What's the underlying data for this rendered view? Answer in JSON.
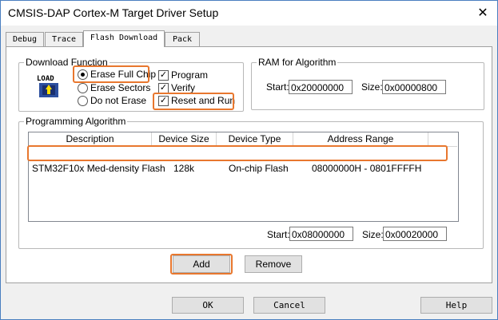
{
  "window": {
    "title": "CMSIS-DAP Cortex-M Target Driver Setup",
    "close_glyph": "✕"
  },
  "tabs": [
    {
      "label": "Debug"
    },
    {
      "label": "Trace"
    },
    {
      "label": "Flash Download"
    },
    {
      "label": "Pack"
    }
  ],
  "download_function": {
    "legend": "Download Function",
    "icon_text": "LOAD",
    "erase_options": [
      {
        "label": "Erase Full Chip",
        "selected": true
      },
      {
        "label": "Erase Sectors",
        "selected": false
      },
      {
        "label": "Do not Erase",
        "selected": false
      }
    ],
    "checks": [
      {
        "label": "Program",
        "checked": true
      },
      {
        "label": "Verify",
        "checked": true
      },
      {
        "label": "Reset and Run",
        "checked": true
      }
    ]
  },
  "ram": {
    "legend": "RAM for Algorithm",
    "start_label": "Start:",
    "start_value": "0x20000000",
    "size_label": "Size:",
    "size_value": "0x00000800"
  },
  "algorithm": {
    "legend": "Programming Algorithm",
    "columns": [
      "Description",
      "Device Size",
      "Device Type",
      "Address Range"
    ],
    "rows": [
      {
        "description": "STM32F10x Med-density Flash",
        "size": "128k",
        "type": "On-chip Flash",
        "range": "08000000H - 0801FFFFH"
      }
    ],
    "start_label": "Start:",
    "start_value": "0x08000000",
    "size_label": "Size:",
    "size_value": "0x00020000",
    "add_label": "Add",
    "remove_label": "Remove"
  },
  "footer": {
    "ok_label": "OK",
    "cancel_label": "Cancel",
    "help_label": "Help"
  },
  "colors": {
    "highlight": "#e8772e",
    "row_selected": "#0078d7"
  }
}
